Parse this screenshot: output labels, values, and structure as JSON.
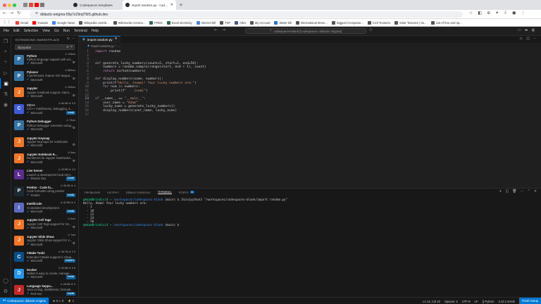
{
  "browser": {
    "tabs": [
      {
        "label": "Codespaces templates",
        "color": "#333"
      },
      {
        "label": "import random.py · codespaces-blank · Codespaces",
        "color": "#111",
        "active": true
      }
    ],
    "url": "didactic-enigma-55p7x29rqf79r5.github.dev",
    "bookmarks": [
      "Gmail",
      "Youtube",
      "Google News",
      "Wikipedia contrib...",
      "Wikimedia Commo...",
      "FRED",
      "Excel electricity",
      "Internet bill",
      "TSP",
      "Altra",
      "My Account",
      "Water bill",
      "International Mone...",
      "Biggest Companie...",
      "CC0 Textures",
      "Solar Textures | So...",
      "List of free and op..."
    ]
  },
  "menu": {
    "items": [
      "File",
      "Edit",
      "Selection",
      "View",
      "Go",
      "Run",
      "Terminal",
      "Help"
    ],
    "command_center": "codespaces-blank [Codespaces: didactic enigma]"
  },
  "sidebar": {
    "title": "EXTENSIONS: MARKETPLACE",
    "search_value": "@popular",
    "extensions": [
      {
        "name": "Python",
        "meta": "⊙ 145ms",
        "desc": "Python language support with ext...",
        "publisher": "Microsoft",
        "action": "gear",
        "icon": "P",
        "color": "#3572a5"
      },
      {
        "name": "Pylance",
        "meta": "⊙ 883ms",
        "desc": "A performant, feature-rich langua...",
        "publisher": "Microsoft",
        "action": "gear",
        "icon": "P",
        "color": "#3572a5"
      },
      {
        "name": "Jupyter",
        "meta": "⊙ 246ms",
        "desc": "Jupyter notebook support, intera...",
        "publisher": "Microsoft",
        "action": "gear",
        "icon": "J",
        "color": "#f37626"
      },
      {
        "name": "C/C++",
        "meta": "⊙ 66.9M ★ 3.5",
        "desc": "C/C++ IntelliSense, debugging, a...",
        "publisher": "Microsoft",
        "action": "Install",
        "icon": "C",
        "color": "#3b5bdb"
      },
      {
        "name": "Python Debugger",
        "meta": "⊙ 73ms",
        "desc": "Python Debugger extension using...",
        "publisher": "Microsoft",
        "action": "gear",
        "icon": "P",
        "color": "#3572a5"
      },
      {
        "name": "Jupyter Keymap",
        "meta": "",
        "desc": "Jupyter keymaps for notebooks",
        "publisher": "Microsoft",
        "action": "gear",
        "icon": "J",
        "color": "#f37626"
      },
      {
        "name": "Jupyter Notebook Rende...",
        "meta": "⊙ 5ms",
        "desc": "Renderers for Jupyter Notebooks...",
        "publisher": "Microsoft",
        "action": "gear",
        "icon": "J",
        "color": "#f37626"
      },
      {
        "name": "Live Server",
        "meta": "⊙ 49.5M ★ 4.5",
        "desc": "Launch a development local Serv...",
        "publisher": "Ritwick Dey",
        "action": "Install",
        "icon": "L",
        "color": "#5c2d91"
      },
      {
        "name": "Prettier - Code fo...",
        "meta": "⊙ 46.3M ★ 4",
        "desc": "Code formatter using prettier",
        "publisher": "Prettier",
        "action": "Install",
        "icon": "P",
        "color": "#1a2b34"
      },
      {
        "name": "IntelliCode",
        "meta": "⊙ 42.5M ★ 4",
        "desc": "AI-assisted development",
        "publisher": "Microsoft",
        "action": "Install",
        "icon": "I",
        "color": "#5c6bc0"
      },
      {
        "name": "Jupyter Cell Tags",
        "meta": "⊙ 6ms",
        "desc": "Jupyter Cell Tags support for VS...",
        "publisher": "Microsoft",
        "action": "gear",
        "icon": "J",
        "color": "#f37626"
      },
      {
        "name": "Jupyter Slide Show",
        "meta": "⊙ 7ms",
        "desc": "Jupyter Slide Show support for V...",
        "publisher": "Microsoft",
        "action": "gear",
        "icon": "J",
        "color": "#f37626"
      },
      {
        "name": "CMake Tools",
        "meta": "⊙ 36.7M ★ 2.5",
        "desc": "Extended CMake support in Visua...",
        "publisher": "Microsoft",
        "action": "Install ▾",
        "icon": "C",
        "color": "#064f8c"
      },
      {
        "name": "Docker",
        "meta": "⊙ 40.6M ★ 4.5",
        "desc": "Makes it easy to create, manage,...",
        "publisher": "Microsoft",
        "action": "Install",
        "icon": "D",
        "color": "#2496ed"
      },
      {
        "name": "Language Suppo...",
        "meta": "⊙ 45.8M ★ 3",
        "desc": "Java Linting, Intellisense, formatti...",
        "publisher": "Red Hat",
        "action": "Install",
        "icon": "J",
        "color": "#c62828"
      }
    ]
  },
  "editor": {
    "tab": "import random.py",
    "breadcrumb": [
      "import random.py",
      "..."
    ],
    "lines": [
      "import random",
      "",
      "",
      "def generate_lucky_numbers(count=5, start=1, end=50):",
      "    numbers = random.sample(range(start, end + 1), count)",
      "    return sorted(numbers)",
      "",
      "def display_numbers(name, numbers):",
      "    print(f\"Hello, {name}! Your lucky numbers are:\")",
      "    for num in numbers:",
      "        print(f\"  - {num}\")",
      "",
      "if __name__ == \"__main__\":",
      "    user_name = \"Adam\"",
      "    lucky_nums = generate_lucky_numbers()",
      "    display_numbers(user_name, lucky_nums)",
      ""
    ]
  },
  "panel": {
    "tabs": [
      "PROBLEMS",
      "OUTPUT",
      "DEBUG CONSOLE",
      "TERMINAL",
      "PORTS"
    ],
    "ports_count": "1",
    "prompt_user": "@AdamBrindisi4",
    "prompt_path": "→ /workspaces/codespaces-blank",
    "prompt_suffix": "(main) $",
    "command": "/bin/python3 \"/workspaces/codespaces-blank/import random.py\"",
    "output": [
      "Hello, Adam! Your lucky numbers are:",
      "  - 1",
      "  - 18",
      "  - 22",
      "  - 24",
      "  - 50"
    ]
  },
  "status": {
    "remote": "Codespaces: didactic enigma",
    "problems": "⊗ 0 ⚠ 0",
    "ports": "⚡ 1",
    "right": [
      "Ln 13, Col 22",
      "Spaces: 4",
      "UTF-8",
      "LF",
      "{} Python",
      "3.12.1 64-bit",
      "Finish Setup"
    ]
  }
}
